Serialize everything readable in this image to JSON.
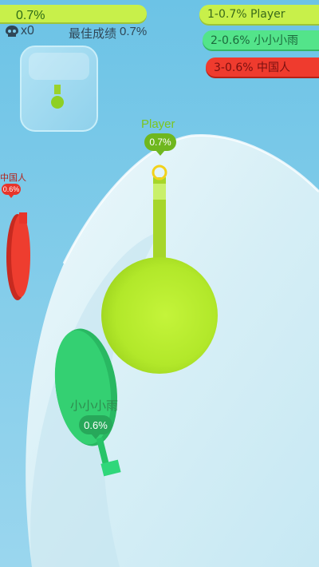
{
  "hud": {
    "progress_text": "0.7%",
    "kill_count": "x0",
    "best_label": "最佳成绩",
    "best_value": "0.7%"
  },
  "leaderboard": [
    {
      "text": "1-0.7% Player",
      "color": "#c8f04a"
    },
    {
      "text": "2-0.6% 小小小雨",
      "color": "#53e48a"
    },
    {
      "text": "3-0.6% 中国人",
      "color": "#ef3b2e"
    }
  ],
  "players": {
    "player": {
      "name": "Player",
      "percent": "0.7%",
      "color": "#b6ec2c"
    },
    "green": {
      "name": "小小小雨",
      "percent": "0.6%",
      "color": "#2fcf6e"
    },
    "red": {
      "name": "中国人",
      "percent": "0.6%",
      "color": "#e8352a"
    }
  },
  "colors": {
    "sky": "#7fcbe9",
    "snow": "#d9f1f8",
    "player": "#b6ec2c",
    "green": "#2fcf6e",
    "red": "#e8352a"
  }
}
